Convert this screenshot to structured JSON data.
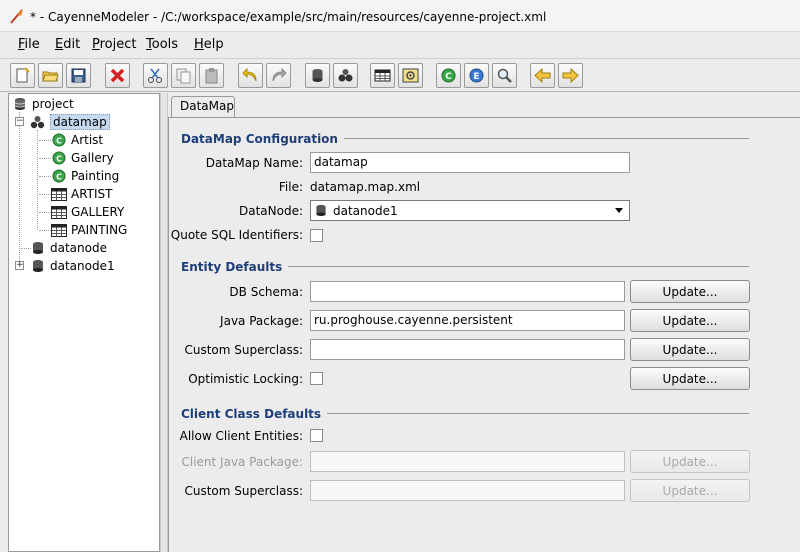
{
  "window": {
    "title": "* - CayenneModeler - /C:/workspace/example/src/main/resources/cayenne-project.xml"
  },
  "menu": {
    "items": [
      {
        "mnemonic": "F",
        "rest": "ile"
      },
      {
        "mnemonic": "E",
        "rest": "dit"
      },
      {
        "mnemonic": "P",
        "rest": "roject"
      },
      {
        "mnemonic": "T",
        "rest": "ools"
      },
      {
        "mnemonic": "H",
        "rest": "elp"
      }
    ]
  },
  "toolbar": {
    "icons": [
      "new-project-icon",
      "open-project-icon",
      "save-icon",
      "remove-icon",
      "cut-icon",
      "copy-icon",
      "paste-icon",
      "undo-icon",
      "redo-icon",
      "create-datanode-icon",
      "create-datamap-icon",
      "create-dbentity-icon",
      "create-procedure-icon",
      "create-objentity-icon",
      "create-embeddable-icon",
      "create-query-icon",
      "navigate-back-icon",
      "navigate-forward-icon"
    ]
  },
  "tree": {
    "root": "project",
    "datamap": "datamap",
    "children": [
      "Artist",
      "Gallery",
      "Painting",
      "ARTIST",
      "GALLERY",
      "PAINTING"
    ],
    "datanode": "datanode",
    "datanode1": "datanode1"
  },
  "tab": {
    "label": "DataMap"
  },
  "config": {
    "section_title": "DataMap Configuration",
    "name_label": "DataMap Name:",
    "name_value": "datamap",
    "file_label": "File:",
    "file_value": "datamap.map.xml",
    "datanode_label": "DataNode:",
    "datanode_value": "datanode1",
    "quote_label": "Quote SQL Identifiers:"
  },
  "entity_defaults": {
    "section_title": "Entity Defaults",
    "schema_label": "DB Schema:",
    "schema_value": "",
    "package_label": "Java Package:",
    "package_value": "ru.proghouse.cayenne.persistent",
    "superclass_label": "Custom Superclass:",
    "superclass_value": "",
    "locking_label": "Optimistic Locking:",
    "update_label": "Update..."
  },
  "client_defaults": {
    "section_title": "Client Class Defaults",
    "allow_label": "Allow Client Entities:",
    "package_label": "Client Java Package:",
    "package_value": "",
    "superclass_label": "Custom Superclass:",
    "superclass_value": "",
    "update_label": "Update..."
  },
  "colors": {
    "section_title": "#1f3f7a",
    "selection": "#c7daf0",
    "panel_bg": "#ececec"
  }
}
